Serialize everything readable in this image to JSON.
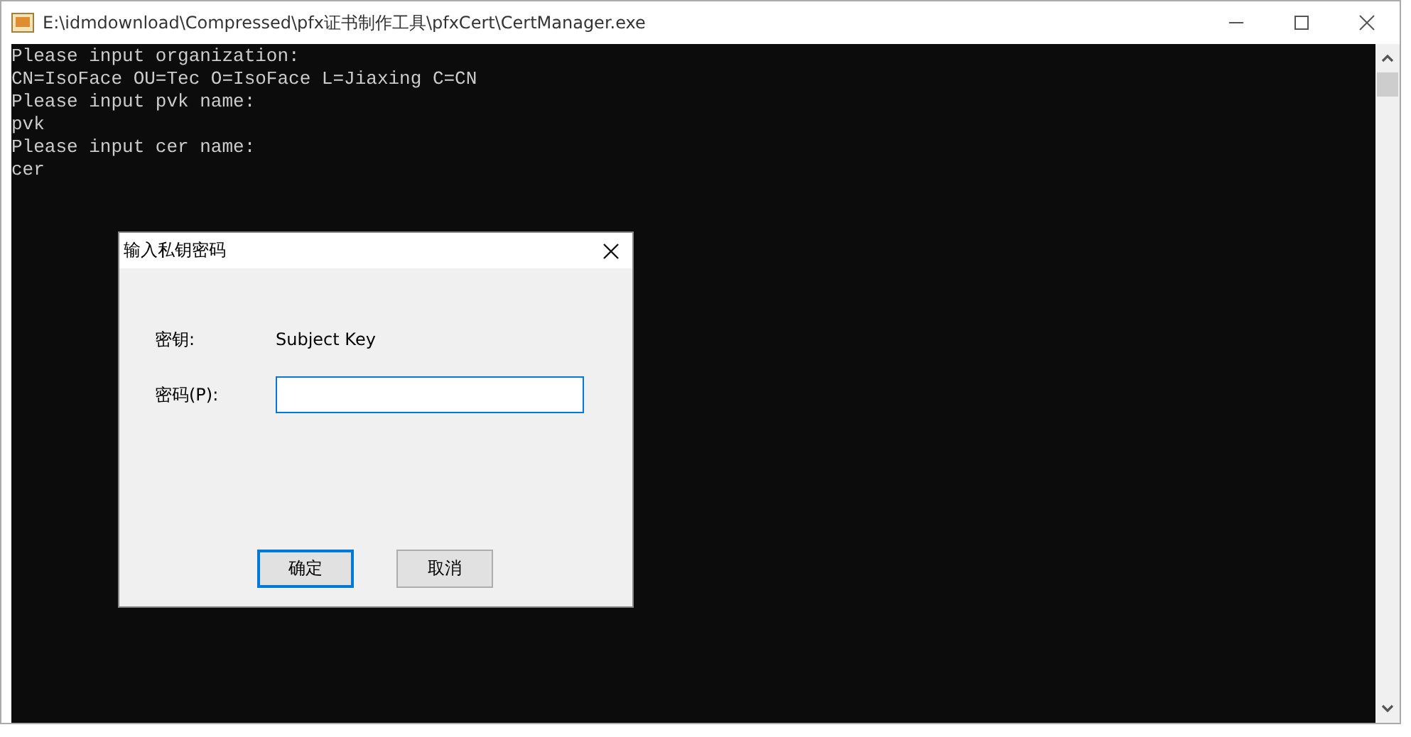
{
  "window": {
    "title": "E:\\idmdownload\\Compressed\\pfx证书制作工具\\pfxCert\\CertManager.exe"
  },
  "console": {
    "lines": [
      "Please input organization:",
      "CN=IsoFace OU=Tec O=IsoFace L=Jiaxing C=CN",
      "Please input pvk name:",
      "pvk",
      "Please input cer name:",
      "cer"
    ]
  },
  "dialog": {
    "title": "输入私钥密码",
    "key_label": "密钥:",
    "key_value": "Subject Key",
    "password_label": "密码(P):",
    "buttons": [
      {
        "label": "确定",
        "default": true
      },
      {
        "label": "取消",
        "default": false
      }
    ]
  }
}
